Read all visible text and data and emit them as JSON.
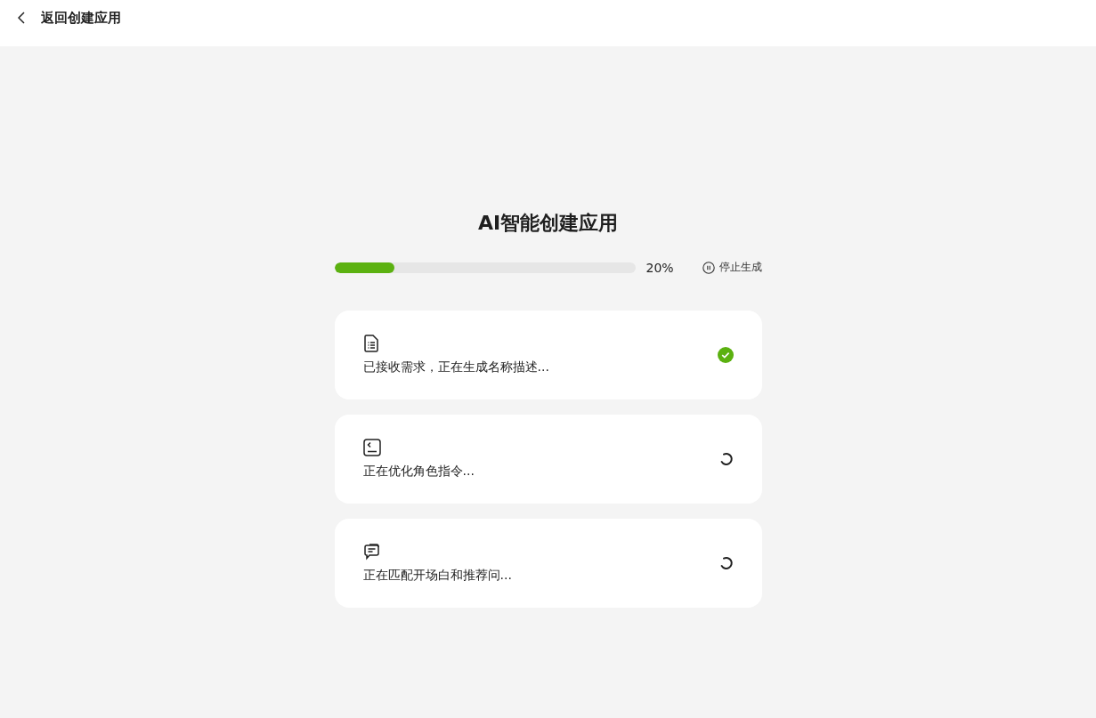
{
  "header": {
    "back_label": "返回创建应用"
  },
  "title": "AI智能创建应用",
  "progress": {
    "level": 0.2,
    "reading": "20%",
    "stop_label": "停止生成"
  },
  "steps": [
    {
      "kind": "document",
      "text": "已接收需求，正在生成名称描述...",
      "completed": true
    },
    {
      "kind": "terminal",
      "text": "正在优化角色指令...",
      "completed": false
    },
    {
      "kind": "chat",
      "text": "正在匹配开场白和推荐问...",
      "completed": false
    }
  ]
}
